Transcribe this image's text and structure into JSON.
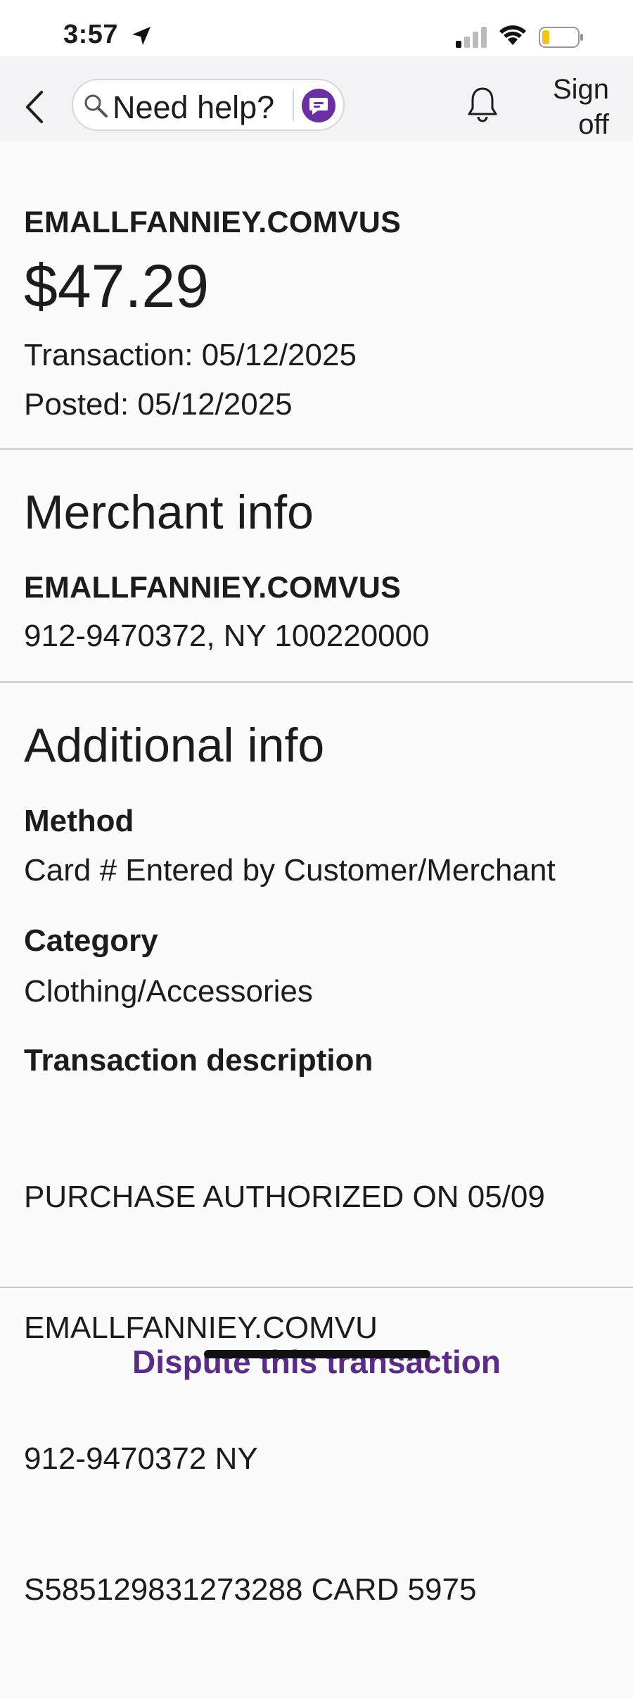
{
  "status_bar": {
    "time": "3:57",
    "icons": [
      "location-arrow-icon",
      "cellular-signal-icon",
      "wifi-icon",
      "battery-low-icon"
    ],
    "battery_level": 0.2
  },
  "nav": {
    "help_placeholder": "Need help?",
    "sign_off_line1": "Sign",
    "sign_off_line2": "off",
    "icons": [
      "back-chevron-icon",
      "search-icon",
      "assistant-icon",
      "bell-icon"
    ],
    "assistant_color": "#6b2fa0"
  },
  "transaction": {
    "merchant": "EMALLFANNIEY.COMVUS",
    "amount": "$47.29",
    "transaction_date": "Transaction: 05/12/2025",
    "posted_date": "Posted: 05/12/2025"
  },
  "merchant_info": {
    "title": "Merchant info",
    "name": "EMALLFANNIEY.COMVUS",
    "address": "912-9470372, NY 100220000"
  },
  "additional_info": {
    "title": "Additional info",
    "method_label": "Method",
    "method_value": "Card # Entered by Customer/Merchant",
    "category_label": "Category",
    "category_value": "Clothing/Accessories",
    "description_label": "Transaction description",
    "description_lines": [
      "PURCHASE AUTHORIZED ON 05/09",
      "EMALLFANNIEY.COMVU",
      "912-9470372 NY",
      "S585129831273288 CARD 5975"
    ]
  },
  "actions": {
    "dispute_label": "Dispute this transaction"
  },
  "colors": {
    "link": "#5a2c86",
    "battery_fill": "#f2c80f"
  }
}
